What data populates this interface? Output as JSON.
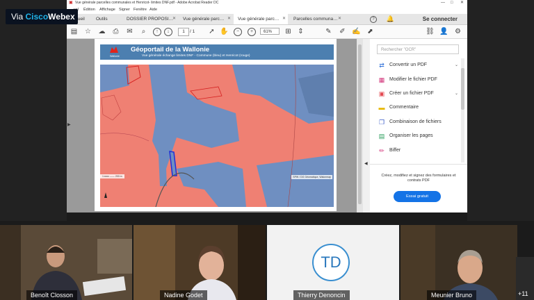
{
  "webex": {
    "prefix": "Via ",
    "brand": "Cisco",
    "product": "Webex"
  },
  "acrobat": {
    "window_title": "Vue générale parcelles communales et Henricot- limites DNF.pdf - Adobe Acrobat Reader DC",
    "menu": [
      "…uel",
      "Édition",
      "Affichage",
      "Signer",
      "Fenêtre",
      "Aide"
    ],
    "tabs": [
      {
        "label": "…cueil"
      },
      {
        "label": "Outils"
      },
      {
        "label": "DOSSIER PROPOSI…",
        "closable": true
      },
      {
        "label": "Vue générale parc…",
        "closable": true
      },
      {
        "label": "Vue générale parc…",
        "closable": true,
        "active": true
      },
      {
        "label": "Parcelles communa…",
        "closable": true
      }
    ],
    "signin_label": "Se connecter",
    "page_current": "1",
    "page_total": "/ 1",
    "zoom": "61%"
  },
  "pdf": {
    "map_title": "Géoportail de la Wallonie",
    "map_subtitle": "Vue générale échange limites DNF - Commune (bleu) et Henricot (rouge)",
    "logo_label": "Wallonie",
    "scale_text": "1:xxxx  ——  200 m",
    "copyright": "SPW / DG Géomatique, Walonmap",
    "colors": {
      "commune": "#6f8fc1",
      "henricot": "#ef8073",
      "header": "#4c7fb0",
      "outline": "#1f2fd6",
      "red_outline": "#d52020"
    }
  },
  "tools_pane": {
    "search_placeholder": "Rechercher \"OCR\"",
    "items": [
      {
        "label": "Convertir un PDF",
        "icon": "convert-pdf-icon",
        "color": "#2d6fd8",
        "expand": true
      },
      {
        "label": "Modifier le fichier PDF",
        "icon": "edit-pdf-icon",
        "color": "#d2337a",
        "expand": false
      },
      {
        "label": "Créer un fichier PDF",
        "icon": "create-pdf-icon",
        "color": "#e34850",
        "expand": true
      },
      {
        "label": "Commentaire",
        "icon": "comment-icon",
        "color": "#e6b600",
        "expand": false
      },
      {
        "label": "Combinaison de fichiers",
        "icon": "combine-icon",
        "color": "#3a5cc7",
        "expand": false
      },
      {
        "label": "Organiser les pages",
        "icon": "organize-icon",
        "color": "#2a9d5a",
        "expand": false
      },
      {
        "label": "Biffer",
        "icon": "redact-icon",
        "color": "#d2337a",
        "expand": false
      }
    ],
    "promo": "Créez, modifiez et signez des formulaires et contrats PDF",
    "trial_button": "Essai gratuit"
  },
  "participants": [
    {
      "name": "Benoît Closson",
      "bg": "#5a4a38"
    },
    {
      "name": "Nadine Godet",
      "bg": "#4d3a26"
    },
    {
      "name": "Thierry Denoncin",
      "bg": "#f2f2f2",
      "initials": "TD"
    },
    {
      "name": "Meunier Bruno",
      "bg": "#3b3023"
    }
  ],
  "more_participants": "+11"
}
